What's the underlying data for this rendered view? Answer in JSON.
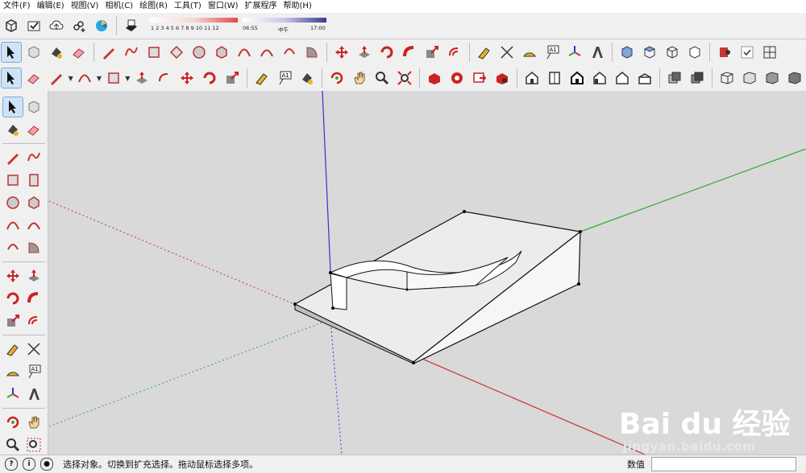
{
  "menu": [
    "文件(F)",
    "编辑(E)",
    "视图(V)",
    "相机(C)",
    "绘图(R)",
    "工具(T)",
    "窗口(W)",
    "扩展程序",
    "帮助(H)"
  ],
  "shadow": {
    "months": "1 2 3 4 5 6 7 8 9 10 11 12",
    "time_start": "06:55",
    "time_mid": "中午",
    "time_end": "17:00"
  },
  "status": {
    "hint": "选择对象。切换到扩充选择。拖动鼠标选择多项。",
    "measure_label": "数值",
    "measure_value": ""
  },
  "watermark": {
    "brand": "Bai du 经验",
    "site": "jingyan.baidu.com"
  },
  "colors": {
    "toolbar_bg": "#f0f0f0",
    "viewport_bg": "#d9d9d9",
    "axis_red": "#cc3333",
    "axis_green": "#33aa33",
    "axis_blue": "#3333cc",
    "face": "#ffffff",
    "side_face": "#cfcfcf"
  }
}
